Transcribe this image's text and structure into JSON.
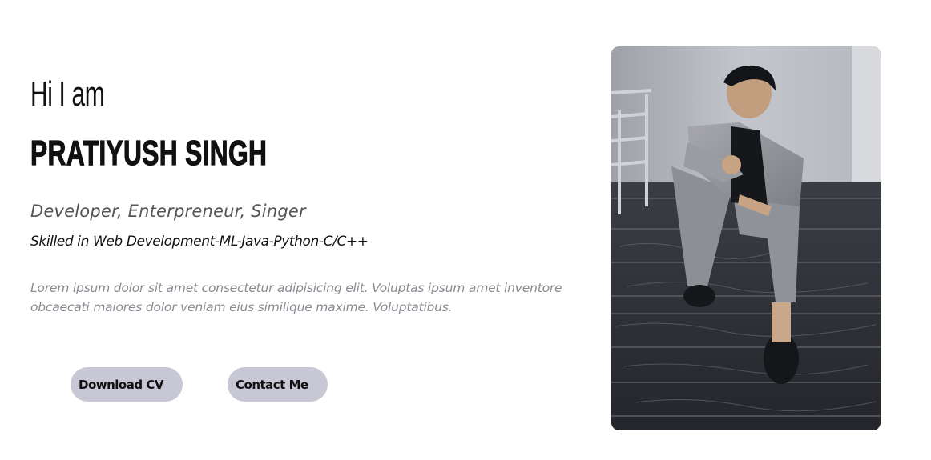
{
  "hero": {
    "greeting": "Hi I am",
    "name": "PRATIYUSH SINGH",
    "roles": "Developer, Enterpreneur, Singer",
    "skills": "Skilled in Web Development-ML-Java-Python-C/C++",
    "description": "Lorem ipsum dolor sit amet consectetur adipisicing elit. Voluptas ipsum amet inventore obcaecati maiores dolor veniam eius similique maxime. Voluptatibus."
  },
  "actions": {
    "download_cv": "Download CV",
    "contact_me": "Contact Me"
  },
  "colors": {
    "button_bg": "#c8c7d6",
    "description_text": "#8a8a92",
    "roles_text": "#555555"
  }
}
